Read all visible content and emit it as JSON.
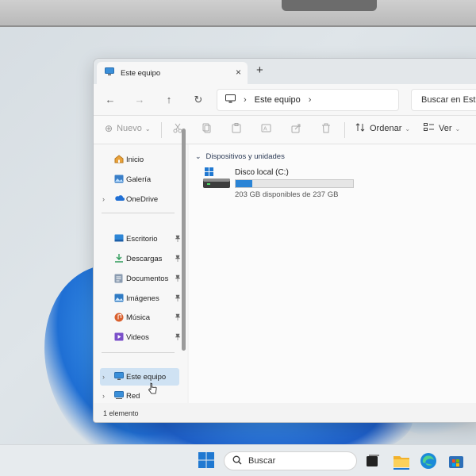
{
  "window": {
    "tab_title": "Este equipo",
    "tab_close": "×",
    "new_tab": "+"
  },
  "nav": {
    "back": "←",
    "forward": "→",
    "up": "↑",
    "refresh": "↻",
    "address_chevron": "›",
    "address_location": "Este equipo",
    "address_trailing_chevron": "›",
    "search_placeholder": "Buscar en Este equipo"
  },
  "commands": {
    "new_label": "Nuevo",
    "new_icon": "⊕",
    "sort_label": "Ordenar",
    "view_label": "Ver",
    "chevron": "⌄"
  },
  "sidebar": {
    "items": [
      {
        "label": "Inicio",
        "icon": "home-icon",
        "expandable": false
      },
      {
        "label": "Galería",
        "icon": "gallery-icon",
        "expandable": false
      },
      {
        "label": "OneDrive",
        "icon": "onedrive-icon",
        "expandable": true
      }
    ],
    "quick_access": [
      {
        "label": "Escritorio",
        "icon": "desktop-folder-icon",
        "pinned": true
      },
      {
        "label": "Descargas",
        "icon": "downloads-icon",
        "pinned": true
      },
      {
        "label": "Documentos",
        "icon": "documents-icon",
        "pinned": true
      },
      {
        "label": "Imágenes",
        "icon": "pictures-icon",
        "pinned": true
      },
      {
        "label": "Música",
        "icon": "music-icon",
        "pinned": true
      },
      {
        "label": "Videos",
        "icon": "videos-icon",
        "pinned": true
      }
    ],
    "locations": [
      {
        "label": "Este equipo",
        "icon": "this-pc-icon",
        "selected": true
      },
      {
        "label": "Red",
        "icon": "network-icon",
        "selected": false
      }
    ],
    "expander": "›",
    "pin": "📌"
  },
  "content": {
    "group_header": "Dispositivos y unidades",
    "group_chevron": "⌄",
    "drive": {
      "name": "Disco local (C:)",
      "free_text": "203 GB disponibles de 237 GB",
      "used_fraction": 0.144,
      "bar_color": "#2a84d6"
    }
  },
  "status": {
    "item_count": "1 elemento"
  },
  "taskbar": {
    "search_label": "Buscar",
    "apps": [
      "task-view-icon",
      "file-explorer-icon",
      "edge-icon",
      "store-icon"
    ]
  },
  "colors": {
    "accent": "#2a84d6",
    "selected_bg": "#cfe2f3"
  }
}
